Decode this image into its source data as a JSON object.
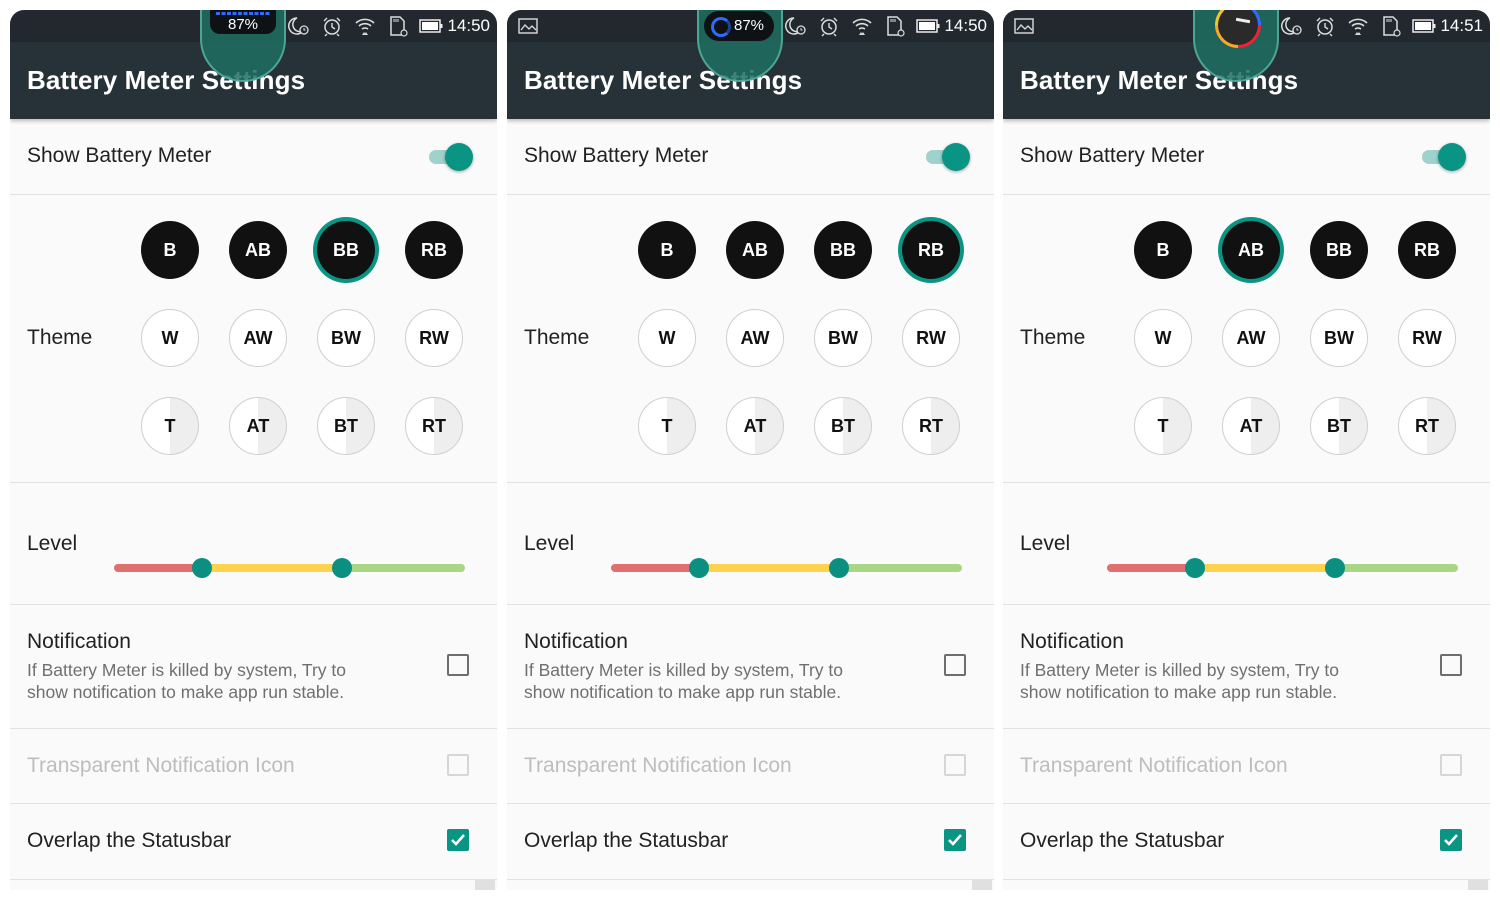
{
  "screens": [
    {
      "status_bar": {
        "left_icon": null,
        "meter_style": "bar",
        "meter_text": "87%",
        "time": "14:50",
        "icons": [
          "moon-alarm-icon",
          "alarm-clock-icon",
          "wifi-icon",
          "sd-card-icon",
          "battery-icon"
        ]
      },
      "title": "Battery Meter Settings",
      "show_meter": {
        "label": "Show Battery Meter",
        "on": true
      },
      "theme": {
        "label": "Theme",
        "selected": "BB",
        "rows": [
          [
            "B",
            "AB",
            "BB",
            "RB"
          ],
          [
            "W",
            "AW",
            "BW",
            "RW"
          ],
          [
            "T",
            "AT",
            "BT",
            "RT"
          ]
        ]
      },
      "level": {
        "label": "Level",
        "low": 0.25,
        "high": 0.65,
        "colors": {
          "low": "#e07070",
          "mid": "#fcd24e",
          "high": "#a9d584",
          "thumb": "#0a8f80"
        }
      },
      "notification": {
        "label": "Notification",
        "description_line1": "If Battery Meter is killed by system, Try to",
        "description_line2": "show notification to make app run stable.",
        "checked": false
      },
      "transparent_icon": {
        "label": "Transparent Notification Icon",
        "checked": false,
        "enabled": false
      },
      "overlap": {
        "label": "Overlap the Statusbar",
        "checked": true
      }
    },
    {
      "status_bar": {
        "left_icon": "image-icon",
        "meter_style": "ring",
        "meter_text": "87%",
        "time": "14:50",
        "icons": [
          "moon-alarm-icon",
          "alarm-clock-icon",
          "wifi-icon",
          "sd-card-icon",
          "battery-icon"
        ]
      },
      "title": "Battery Meter Settings",
      "show_meter": {
        "label": "Show Battery Meter",
        "on": true
      },
      "theme": {
        "label": "Theme",
        "selected": "RB",
        "rows": [
          [
            "B",
            "AB",
            "BB",
            "RB"
          ],
          [
            "W",
            "AW",
            "BW",
            "RW"
          ],
          [
            "T",
            "AT",
            "BT",
            "RT"
          ]
        ]
      },
      "level": {
        "label": "Level",
        "low": 0.25,
        "high": 0.65,
        "colors": {
          "low": "#e07070",
          "mid": "#fcd24e",
          "high": "#a9d584",
          "thumb": "#0a8f80"
        }
      },
      "notification": {
        "label": "Notification",
        "description_line1": "If Battery Meter is killed by system, Try to",
        "description_line2": "show notification to make app run stable.",
        "checked": false
      },
      "transparent_icon": {
        "label": "Transparent Notification Icon",
        "checked": false,
        "enabled": false
      },
      "overlap": {
        "label": "Overlap the Statusbar",
        "checked": true
      }
    },
    {
      "status_bar": {
        "left_icon": "image-icon",
        "meter_style": "gauge",
        "meter_text": "",
        "time": "14:51",
        "icons": [
          "moon-alarm-icon",
          "alarm-clock-icon",
          "wifi-icon",
          "sd-card-icon",
          "battery-icon"
        ]
      },
      "title": "Battery Meter Settings",
      "show_meter": {
        "label": "Show Battery Meter",
        "on": true
      },
      "theme": {
        "label": "Theme",
        "selected": "AB",
        "rows": [
          [
            "B",
            "AB",
            "BB",
            "RB"
          ],
          [
            "W",
            "AW",
            "BW",
            "RW"
          ],
          [
            "T",
            "AT",
            "BT",
            "RT"
          ]
        ]
      },
      "level": {
        "label": "Level",
        "low": 0.25,
        "high": 0.65,
        "colors": {
          "low": "#e07070",
          "mid": "#fcd24e",
          "high": "#a9d584",
          "thumb": "#0a8f80"
        }
      },
      "notification": {
        "label": "Notification",
        "description_line1": "If Battery Meter is killed by system, Try to",
        "description_line2": "show notification to make app run stable.",
        "checked": false
      },
      "transparent_icon": {
        "label": "Transparent Notification Icon",
        "checked": false,
        "enabled": false
      },
      "overlap": {
        "label": "Overlap the Statusbar",
        "checked": true
      }
    }
  ]
}
